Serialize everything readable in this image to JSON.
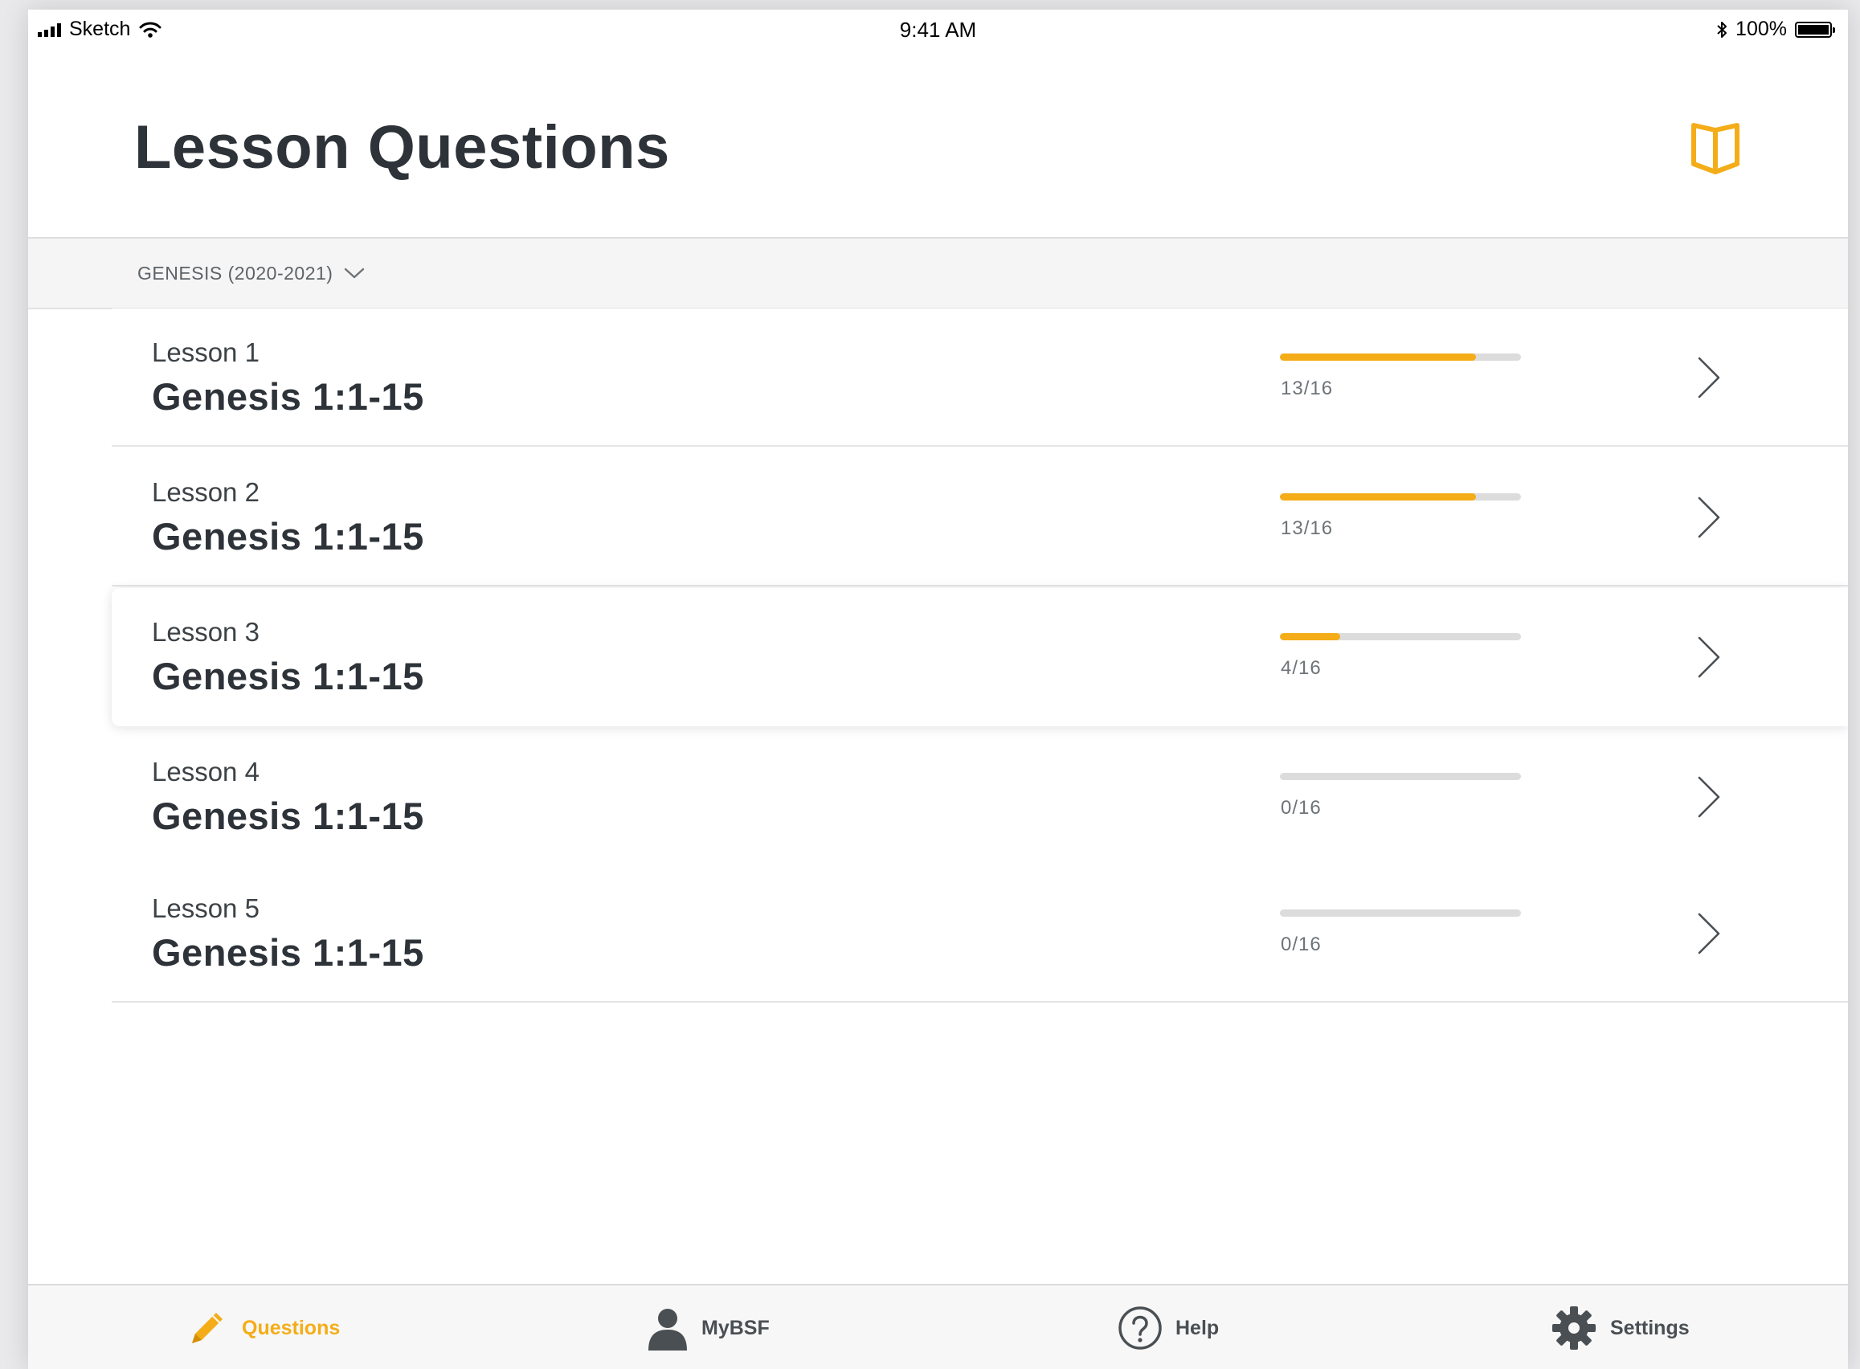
{
  "status_bar": {
    "carrier": "Sketch",
    "time": "9:41 AM",
    "battery": "100%",
    "battery_level": 1.0
  },
  "header": {
    "title": "Lesson Questions",
    "book_icon": "open-book-icon"
  },
  "filter": {
    "label": "GENESIS (2020-2021)"
  },
  "lessons": [
    {
      "number": "Lesson 1",
      "reference": "Genesis 1:1-15",
      "progress_label": "13/16",
      "progress": 0.8125
    },
    {
      "number": "Lesson 2",
      "reference": "Genesis 1:1-15",
      "progress_label": "13/16",
      "progress": 0.8125
    },
    {
      "number": "Lesson 3",
      "reference": "Genesis 1:1-15",
      "progress_label": "4/16",
      "progress": 0.25
    },
    {
      "number": "Lesson 4",
      "reference": "Genesis 1:1-15",
      "progress_label": "0/16",
      "progress": 0
    },
    {
      "number": "Lesson 5",
      "reference": "Genesis 1:1-15",
      "progress_label": "0/16",
      "progress": 0
    }
  ],
  "tabbar": {
    "questions": "Questions",
    "mybsf": "MyBSF",
    "help": "Help",
    "settings": "Settings"
  },
  "colors": {
    "accent": "#f4ad18",
    "text_dark": "#2d3338",
    "track": "#dcdcdc"
  }
}
